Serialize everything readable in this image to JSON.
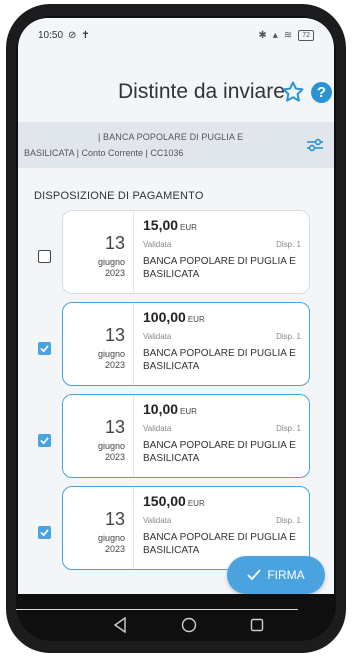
{
  "status_bar": {
    "time": "10:50",
    "battery": "72"
  },
  "header": {
    "title": "Distinte da inviare",
    "help_label": "?"
  },
  "account": {
    "line1": "| BANCA POPOLARE DI PUGLIA E",
    "line2": "BASILICATA | Conto Corrente | CC1036"
  },
  "section": {
    "title": "DISPOSIZIONE DI PAGAMENTO"
  },
  "payments": [
    {
      "day": "13",
      "month": "giugno",
      "year": "2023",
      "amount": "15,00",
      "currency": "EUR",
      "status": "Validata",
      "disp": "Disp. 1",
      "bank": "BANCA POPOLARE DI PUGLIA E BASILICATA",
      "checked": false
    },
    {
      "day": "13",
      "month": "giugno",
      "year": "2023",
      "amount": "100,00",
      "currency": "EUR",
      "status": "Validata",
      "disp": "Disp. 1",
      "bank": "BANCA POPOLARE DI PUGLIA E BASILICATA",
      "checked": true
    },
    {
      "day": "13",
      "month": "giugno",
      "year": "2023",
      "amount": "10,00",
      "currency": "EUR",
      "status": "Validata",
      "disp": "Disp. 1",
      "bank": "BANCA POPOLARE DI PUGLIA E BASILICATA",
      "checked": true
    },
    {
      "day": "13",
      "month": "giugno",
      "year": "2023",
      "amount": "150,00",
      "currency": "EUR",
      "status": "Validata",
      "disp": "Disp. 1",
      "bank": "BANCA POPOLARE DI PUGLIA E BASILICATA",
      "checked": true
    }
  ],
  "actions": {
    "firma_label": "FIRMA"
  },
  "colors": {
    "accent": "#4aa3df",
    "help": "#2a93d5",
    "star": "#2a93d5"
  },
  "icons": {
    "star": "star-icon",
    "help": "help-icon",
    "filter": "filter-icon",
    "check": "check-icon",
    "back": "back-icon",
    "home": "home-icon",
    "recents": "recents-icon"
  }
}
